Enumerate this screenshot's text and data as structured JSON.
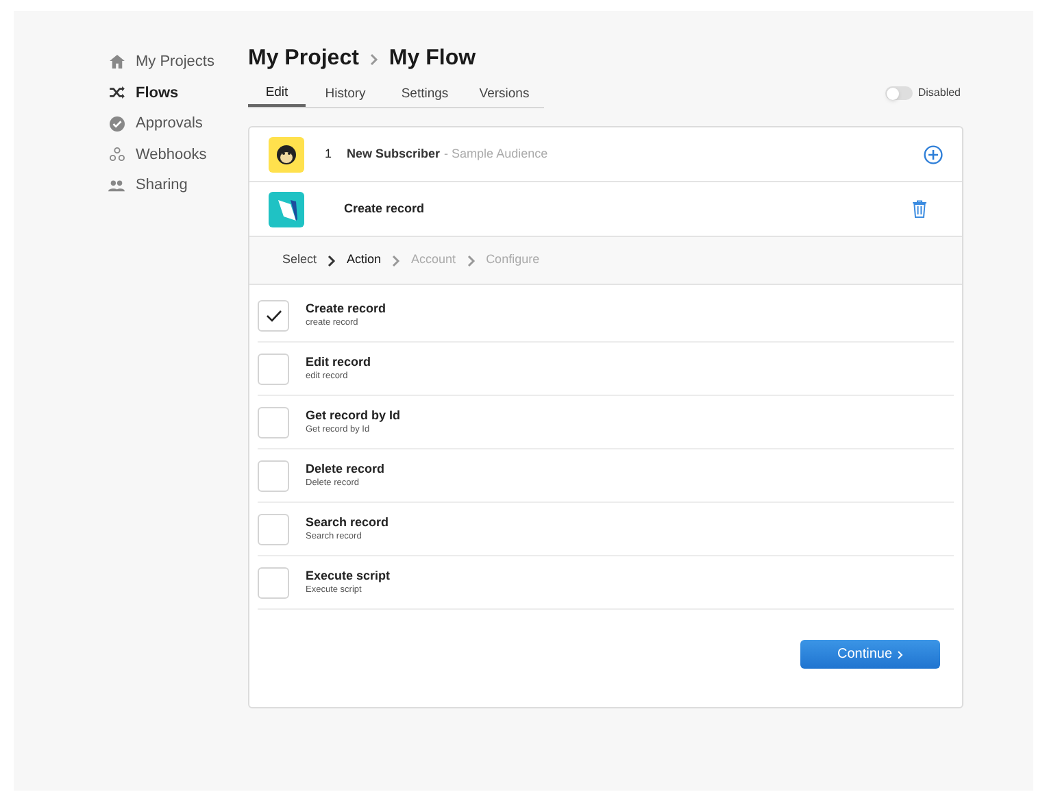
{
  "sidebar": {
    "items": [
      {
        "label": "My Projects",
        "selected": false
      },
      {
        "label": "Flows",
        "selected": true
      },
      {
        "label": "Approvals",
        "selected": false
      },
      {
        "label": "Webhooks",
        "selected": false
      },
      {
        "label": "Sharing",
        "selected": false
      }
    ]
  },
  "breadcrumb": [
    "My Project",
    "My Flow"
  ],
  "tabs": [
    {
      "label": "Edit",
      "selected": true
    },
    {
      "label": "History",
      "selected": false
    },
    {
      "label": "Settings",
      "selected": false
    },
    {
      "label": "Versions",
      "selected": false
    }
  ],
  "toggle": {
    "on": false,
    "label": "Disabled"
  },
  "trigger": {
    "number": "1",
    "title": "New Subscriber",
    "subtitle": "- Sample Audience"
  },
  "action_step": {
    "title": "Create record"
  },
  "steps": [
    {
      "label": "Select",
      "selected": false
    },
    {
      "label": "Action",
      "selected": true
    },
    {
      "label": "Account",
      "selected": false
    },
    {
      "label": "Configure",
      "selected": false
    }
  ],
  "actions": [
    {
      "title": "Create record",
      "description": "create record",
      "checked": true
    },
    {
      "title": "Edit record",
      "description": "edit record",
      "checked": false
    },
    {
      "title": "Get record by Id",
      "description": "Get record by Id",
      "checked": false
    },
    {
      "title": "Delete record",
      "description": "Delete record",
      "checked": false
    },
    {
      "title": "Search record",
      "description": "Search record",
      "checked": false
    },
    {
      "title": "Execute script",
      "description": "Execute script",
      "checked": false
    }
  ],
  "continue_button": "Continue"
}
